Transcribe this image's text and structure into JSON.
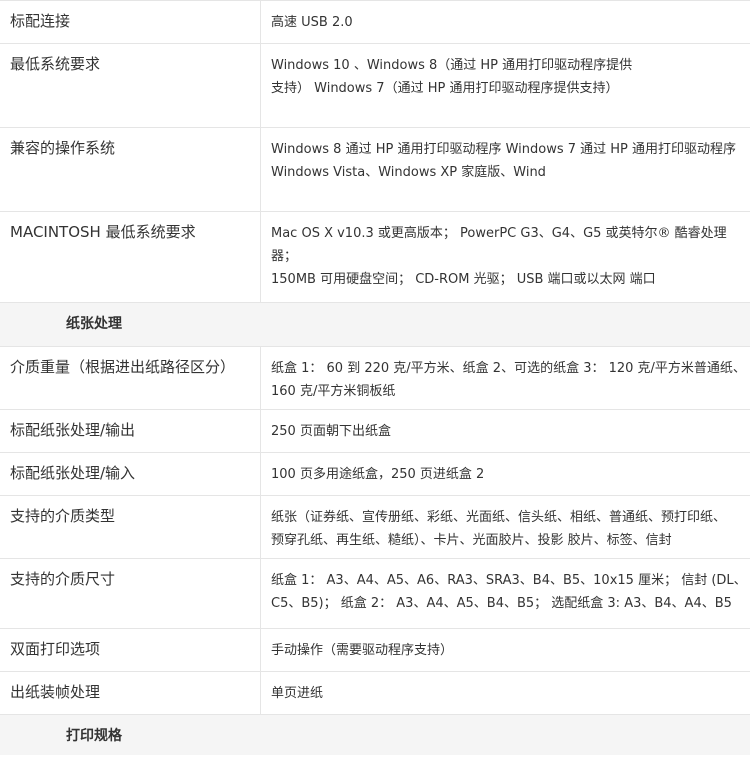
{
  "rows_top": [
    {
      "label": "标配连接",
      "value": "高速 USB 2.0"
    },
    {
      "label": "最低系统要求",
      "value": "Windows 10 、Windows 8（通过 HP 通用打印驱动程序提供\n支持） Windows 7（通过 HP 通用打印驱动程序提供支持）"
    },
    {
      "label": "兼容的操作系统",
      "value": "Windows 8 通过 HP 通用打印驱动程序 Windows 7 通过 HP 通用打印驱动程序\n Windows Vista、Windows XP 家庭版、Wind"
    },
    {
      "label": "MACINTOSH 最低系统要求",
      "value": "Mac OS X v10.3 或更高版本； PowerPC G3、G4、G5 或英特尔® 酷睿处理器；\n150MB 可用硬盘空间； CD-ROM 光驱； USB 端口或以太网 端口"
    }
  ],
  "section_paper": "纸张处理",
  "rows_paper": [
    {
      "label": "介质重量（根据进出纸路径区分）",
      "value": "纸盒 1： 60 到 220 克/平方米、纸盒 2、可选的纸盒 3： 120 克/平方米普通纸、\n160 克/平方米铜板纸"
    },
    {
      "label": "标配纸张处理/输出",
      "value": "250 页面朝下出纸盒"
    },
    {
      "label": "标配纸张处理/输入",
      "value": "100 页多用途纸盒，250 页进纸盒 2"
    },
    {
      "label": "支持的介质类型",
      "value": "纸张（证券纸、宣传册纸、彩纸、光面纸、信头纸、相纸、普通纸、预打印纸、\n预穿孔纸、再生纸、糙纸）、卡片、光面胶片、投影 胶片、标签、信封"
    },
    {
      "label": "支持的介质尺寸",
      "value": "纸盒 1： A3、A4、A5、A6、RA3、SRA3、B4、B5、10x15 厘米； 信封 (DL、\nC5、B5)； 纸盒 2： A3、A4、A5、B4、B5； 选配纸盒 3: A3、B4、A4、B5"
    },
    {
      "label": "双面打印选项",
      "value": "手动操作（需要驱动程序支持）"
    },
    {
      "label": "出纸装帧处理",
      "value": "单页进纸"
    }
  ],
  "section_print": "打印规格"
}
